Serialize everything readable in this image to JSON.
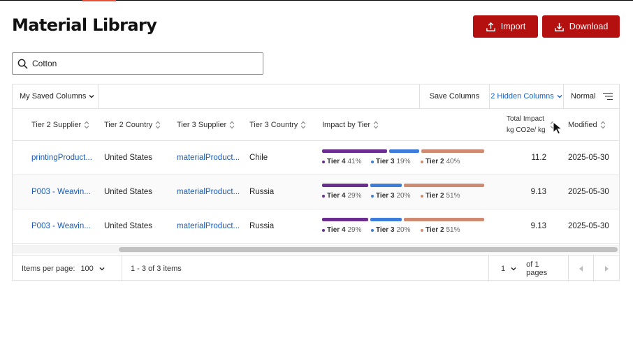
{
  "page": {
    "title": "Material Library"
  },
  "actions": {
    "import_label": "Import",
    "download_label": "Download"
  },
  "search": {
    "value": "Cotton"
  },
  "toolbar": {
    "saved_columns": "My Saved Columns",
    "save_columns": "Save Columns",
    "hidden_columns": "2 Hidden Columns",
    "density": "Normal"
  },
  "columns": {
    "tier2_supplier": "Tier 2 Supplier",
    "tier2_country": "Tier 2 Country",
    "tier3_supplier": "Tier 3 Supplier",
    "tier3_country": "Tier 3 Country",
    "impact_by_tier": "Impact by Tier",
    "total_impact_line1": "Total Impact",
    "total_impact_line2": "kg CO2e/ kg",
    "modified": "Modified"
  },
  "rows": [
    {
      "tier2_supplier": "printingProduct...",
      "tier2_country": "United States",
      "tier3_supplier": "materialProduct...",
      "tier3_country": "Chile",
      "tiers": [
        {
          "label": "Tier 4",
          "pct": "41%",
          "value": 41,
          "color": "#6b2d8f"
        },
        {
          "label": "Tier 3",
          "pct": "19%",
          "value": 19,
          "color": "#3b7dd8"
        },
        {
          "label": "Tier 2",
          "pct": "40%",
          "value": 40,
          "color": "#cf8a72"
        }
      ],
      "total_impact": "11.2",
      "modified": "2025-05-30"
    },
    {
      "tier2_supplier": "P003 - Weavin...",
      "tier2_country": "United States",
      "tier3_supplier": "materialProduct...",
      "tier3_country": "Russia",
      "tiers": [
        {
          "label": "Tier 4",
          "pct": "29%",
          "value": 29,
          "color": "#6b2d8f"
        },
        {
          "label": "Tier 3",
          "pct": "20%",
          "value": 20,
          "color": "#3b7dd8"
        },
        {
          "label": "Tier 2",
          "pct": "51%",
          "value": 51,
          "color": "#cf8a72"
        }
      ],
      "total_impact": "9.13",
      "modified": "2025-05-30"
    },
    {
      "tier2_supplier": "P003 - Weavin...",
      "tier2_country": "United States",
      "tier3_supplier": "materialProduct...",
      "tier3_country": "Russia",
      "tiers": [
        {
          "label": "Tier 4",
          "pct": "29%",
          "value": 29,
          "color": "#6b2d8f"
        },
        {
          "label": "Tier 3",
          "pct": "20%",
          "value": 20,
          "color": "#3b7dd8"
        },
        {
          "label": "Tier 2",
          "pct": "51%",
          "value": 51,
          "color": "#cf8a72"
        }
      ],
      "total_impact": "9.13",
      "modified": "2025-05-30"
    }
  ],
  "footer": {
    "items_per_page_label": "Items per page:",
    "items_per_page_value": "100",
    "range_text": "1 - 3 of 3 items",
    "page_value": "1",
    "page_of_text": "of 1 pages"
  },
  "icons": {
    "import": "upload-icon",
    "download": "download-icon",
    "search": "search-icon",
    "filter": "filter-settings-icon",
    "sort": "sort-arrows-icon",
    "prev": "caret-left-icon",
    "next": "caret-right-icon"
  },
  "colors": {
    "brand": "#b3100f",
    "link": "#1a5ab8",
    "tier4": "#6b2d8f",
    "tier3": "#3b7dd8",
    "tier2": "#cf8a72"
  }
}
